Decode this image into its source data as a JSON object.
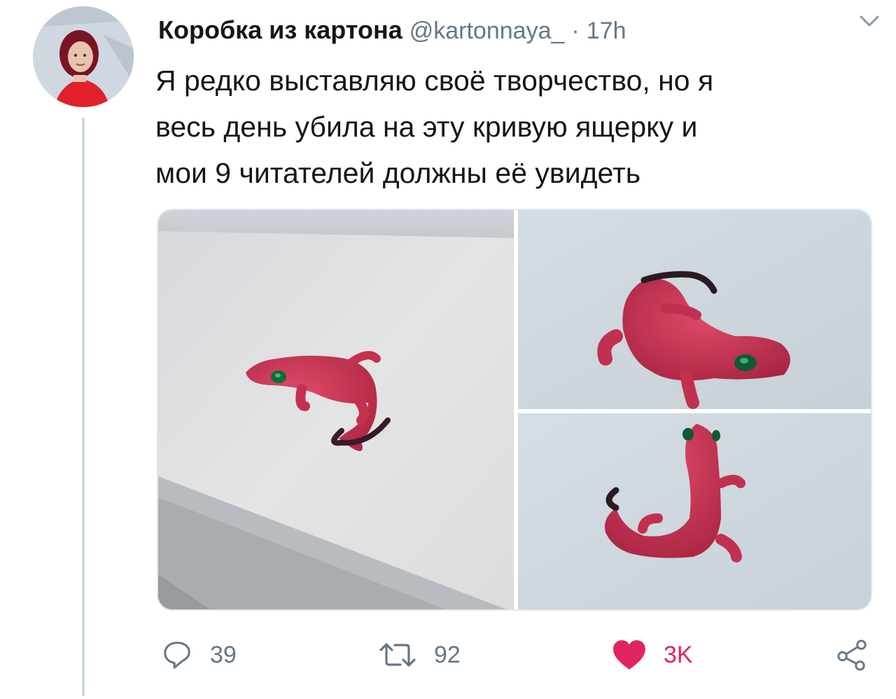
{
  "tweet": {
    "display_name": "Коробка из картона",
    "handle": "@kartonnaya_",
    "separator": "·",
    "time": "17h",
    "text_lines": [
      "Я редко выставляю своё творчество, но я",
      "весь день убила на эту кривую ящерку и",
      "мои 9 читателей должны её увидеть"
    ],
    "media": [
      {
        "icon": "lizard-photo",
        "description_icon": "photo"
      },
      {
        "icon": "lizard-photo",
        "description_icon": "photo"
      },
      {
        "icon": "lizard-photo",
        "description_icon": "photo"
      }
    ],
    "actions": {
      "reply": {
        "icon": "reply-icon",
        "count": "39"
      },
      "retweet": {
        "icon": "retweet-icon",
        "count": "92"
      },
      "like": {
        "icon": "heart-icon",
        "count": "3K",
        "liked": true
      },
      "share": {
        "icon": "share-icon"
      }
    }
  },
  "colors": {
    "text": "#14171a",
    "secondary": "#657786",
    "like": "#e0245e",
    "divider": "#ccd6dd",
    "lizard": "#c8304f"
  }
}
